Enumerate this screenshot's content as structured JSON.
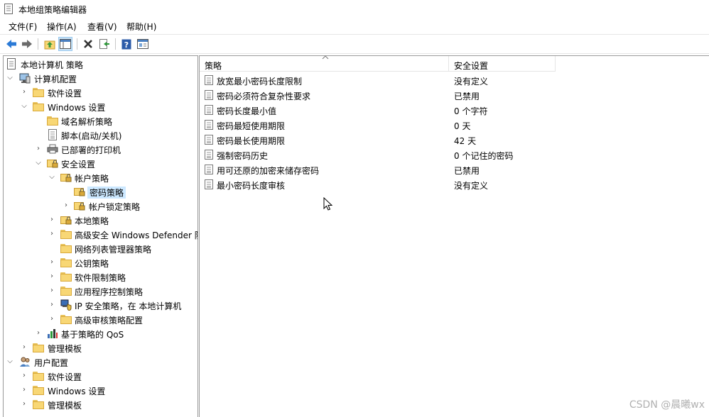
{
  "window": {
    "title": "本地组策略编辑器"
  },
  "menu": [
    "文件(F)",
    "操作(A)",
    "查看(V)",
    "帮助(H)"
  ],
  "toolbar": {
    "buttons": [
      "back-icon",
      "forward-icon",
      "up-folder-icon",
      "show-hide-tree-icon",
      "delete-icon",
      "export-icon",
      "help-icon",
      "properties-icon"
    ]
  },
  "tree": {
    "root": "本地计算机 策略",
    "computer_config": "计算机配置",
    "software_settings": "软件设置",
    "windows_settings": "Windows 设置",
    "dns_policy": "域名解析策略",
    "scripts": "脚本(启动/关机)",
    "printers": "已部署的打印机",
    "security_settings": "安全设置",
    "account_policy": "帐户策略",
    "password_policy": "密码策略",
    "lockout_policy": "帐户锁定策略",
    "local_policy": "本地策略",
    "defender_firewall": "高级安全 Windows Defender 防火墙",
    "network_list": "网络列表管理器策略",
    "public_key": "公钥策略",
    "software_restriction": "软件限制策略",
    "app_control": "应用程序控制策略",
    "ip_security": "IP 安全策略，在 本地计算机",
    "audit_config": "高级审核策略配置",
    "qos": "基于策略的 QoS",
    "admin_templates": "管理模板",
    "user_config": "用户配置",
    "user_software": "软件设置",
    "user_windows": "Windows 设置",
    "user_admin_templates": "管理模板"
  },
  "list": {
    "headers": {
      "policy": "策略",
      "setting": "安全设置"
    },
    "rows": [
      {
        "name": "放宽最小密码长度限制",
        "value": "没有定义"
      },
      {
        "name": "密码必须符合复杂性要求",
        "value": "已禁用"
      },
      {
        "name": "密码长度最小值",
        "value": "0 个字符"
      },
      {
        "name": "密码最短使用期限",
        "value": "0 天"
      },
      {
        "name": "密码最长使用期限",
        "value": "42 天"
      },
      {
        "name": "强制密码历史",
        "value": "0 个记住的密码"
      },
      {
        "name": "用可还原的加密来储存密码",
        "value": "已禁用"
      },
      {
        "name": "最小密码长度审核",
        "value": "没有定义"
      }
    ]
  },
  "watermark": "CSDN @晨曦wx"
}
